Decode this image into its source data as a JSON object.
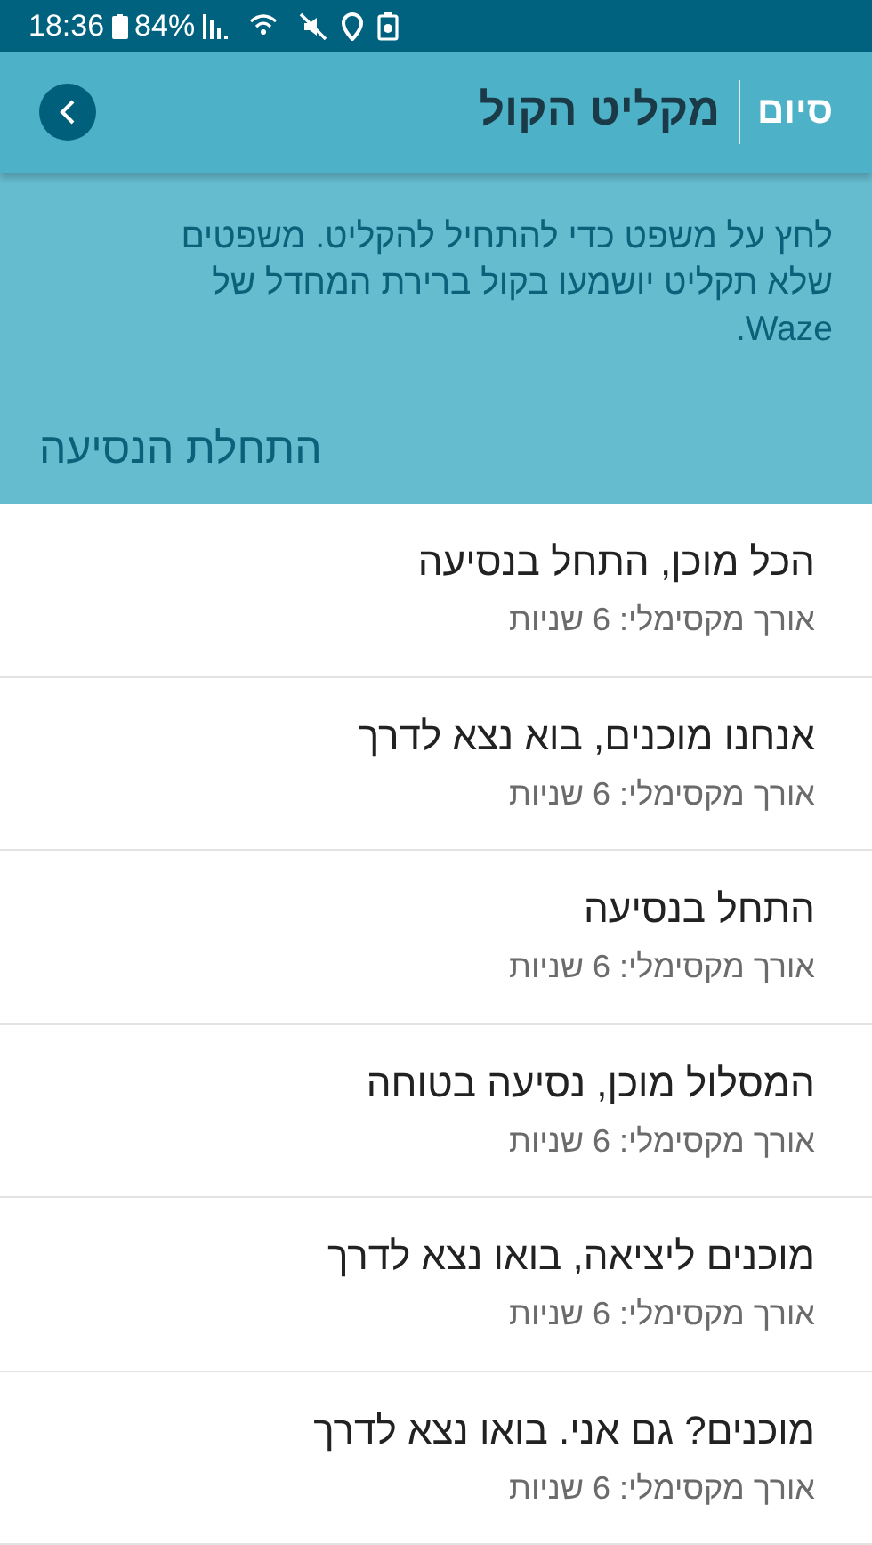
{
  "status_bar": {
    "time": "18:36",
    "battery": "84%"
  },
  "header": {
    "title": "מקליט הקול",
    "done": "סיום"
  },
  "description": "לחץ על משפט כדי להתחיל להקליט. משפטים שלא תקליט יושמעו בקול ברירת המחדל של Waze.",
  "section": "התחלת הנסיעה",
  "items": [
    {
      "title": "הכל מוכן, התחל בנסיעה",
      "subtitle": "אורך מקסימלי: 6 שניות"
    },
    {
      "title": "אנחנו מוכנים, בוא נצא לדרך",
      "subtitle": "אורך מקסימלי: 6 שניות"
    },
    {
      "title": "התחל בנסיעה",
      "subtitle": "אורך מקסימלי: 6 שניות"
    },
    {
      "title": "המסלול מוכן, נסיעה בטוחה",
      "subtitle": "אורך מקסימלי: 6 שניות"
    },
    {
      "title": "מוכנים ליציאה, בואו נצא לדרך",
      "subtitle": "אורך מקסימלי: 6 שניות"
    },
    {
      "title": "מוכנים? גם אני. בואו נצא לדרך",
      "subtitle": "אורך מקסימלי: 6 שניות"
    }
  ]
}
